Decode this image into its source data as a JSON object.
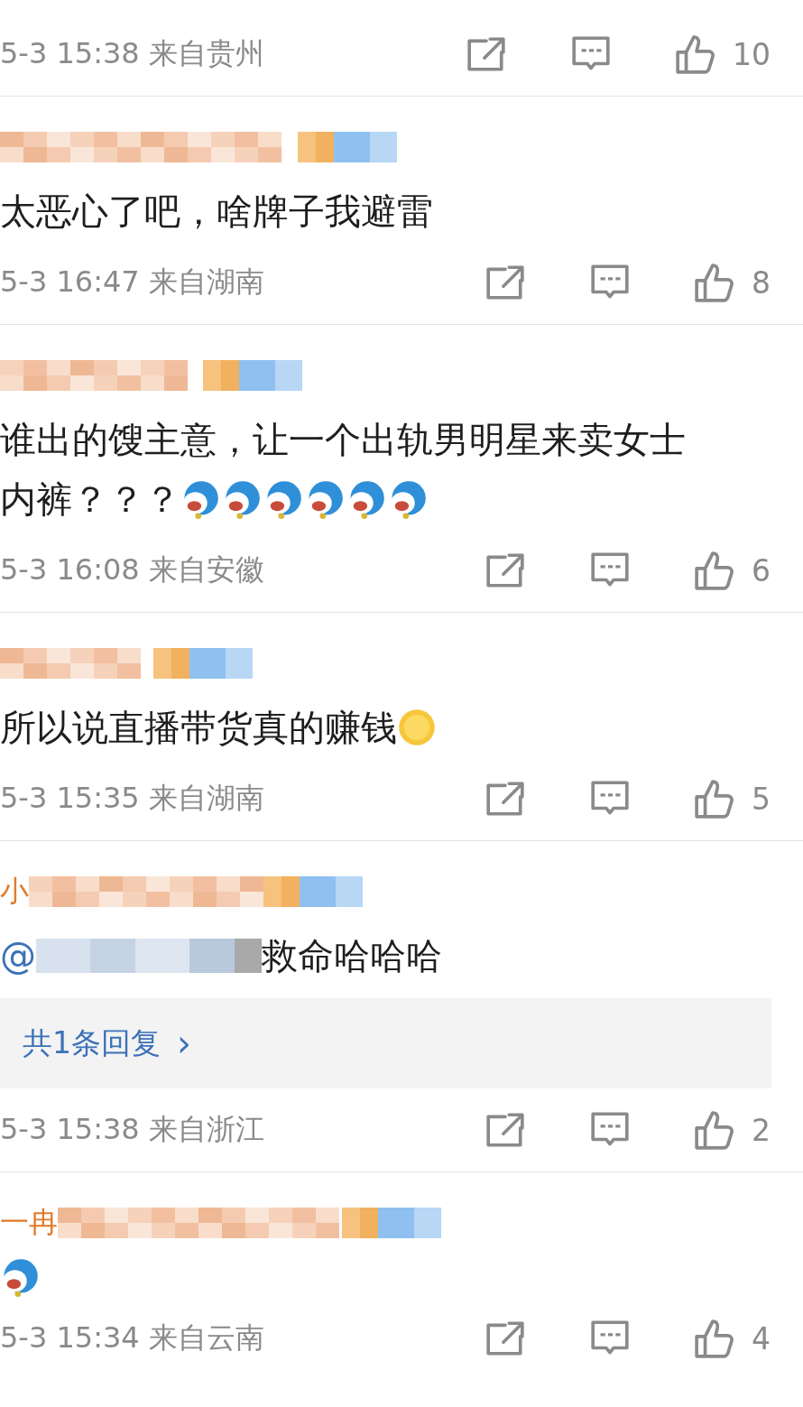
{
  "comments": [
    {
      "time": "5-3 15:38",
      "location": "来自贵州",
      "likes": "10"
    },
    {
      "content": [
        {
          "kind": "text",
          "text": "太恶心了吧，啥牌子我避雷"
        }
      ],
      "time": "5-3 16:47",
      "location": "来自湖南",
      "likes": "8"
    },
    {
      "content": [
        {
          "kind": "text",
          "text": "谁出的馊主意，让一个出轨男明星来卖女士"
        },
        {
          "kind": "text",
          "text": "内裤？？？"
        },
        {
          "kind": "emoji_blue"
        },
        {
          "kind": "emoji_blue"
        },
        {
          "kind": "emoji_blue"
        },
        {
          "kind": "emoji_blue"
        },
        {
          "kind": "emoji_blue"
        },
        {
          "kind": "emoji_blue"
        }
      ],
      "time": "5-3 16:08",
      "location": "来自安徽",
      "likes": "6"
    },
    {
      "content": [
        {
          "kind": "text",
          "text": "所以说直播带货真的赚钱"
        },
        {
          "kind": "emoji_yellow"
        }
      ],
      "time": "5-3 15:35",
      "location": "来自湖南",
      "likes": "5"
    },
    {
      "name_prefix": "小",
      "content": [
        {
          "kind": "link",
          "text": "@"
        },
        {
          "kind": "blur"
        },
        {
          "kind": "text",
          "text": "救命哈哈哈"
        }
      ],
      "replies_label": "共1条回复",
      "replies_arrow": "›",
      "time": "5-3 15:38",
      "location": "来自浙江",
      "likes": "2"
    },
    {
      "name_prefix": "一冉",
      "content": [
        {
          "kind": "emoji_blue"
        }
      ],
      "time": "5-3 15:34",
      "location": "来自云南",
      "likes": "4"
    }
  ]
}
